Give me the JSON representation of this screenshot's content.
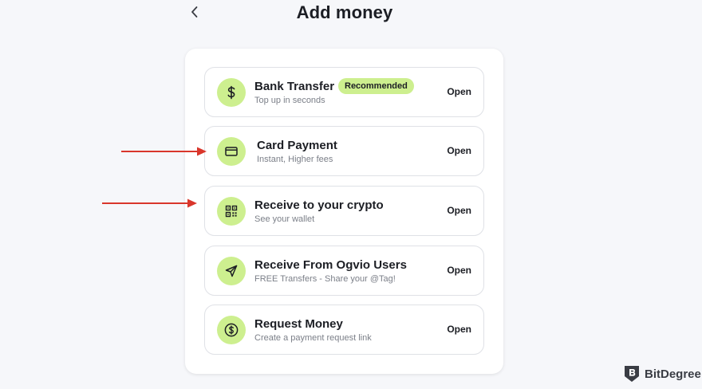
{
  "header": {
    "title": "Add money",
    "back_icon": "chevron-left-icon"
  },
  "options": [
    {
      "title": "Bank Transfer",
      "subtitle": "Top up in seconds",
      "action": "Open",
      "badge": "Recommended",
      "icon": "dollar-icon"
    },
    {
      "title": "Card Payment",
      "subtitle": "Instant, Higher fees",
      "action": "Open",
      "icon": "credit-card-icon"
    },
    {
      "title": "Receive to your crypto",
      "subtitle": "See your wallet",
      "action": "Open",
      "icon": "qr-code-icon"
    },
    {
      "title": "Receive From Ogvio Users",
      "subtitle": "FREE Transfers - Share your @Tag!",
      "action": "Open",
      "icon": "send-icon"
    },
    {
      "title": "Request Money",
      "subtitle": "Create a payment request link",
      "action": "Open",
      "icon": "dollar-circle-icon"
    }
  ],
  "watermark": {
    "text": "BitDegree",
    "icon": "bitdegree-shield-icon"
  },
  "colors": {
    "accent": "#cdef8f",
    "background": "#f6f7fa",
    "annotation_arrow": "#d9362b"
  }
}
